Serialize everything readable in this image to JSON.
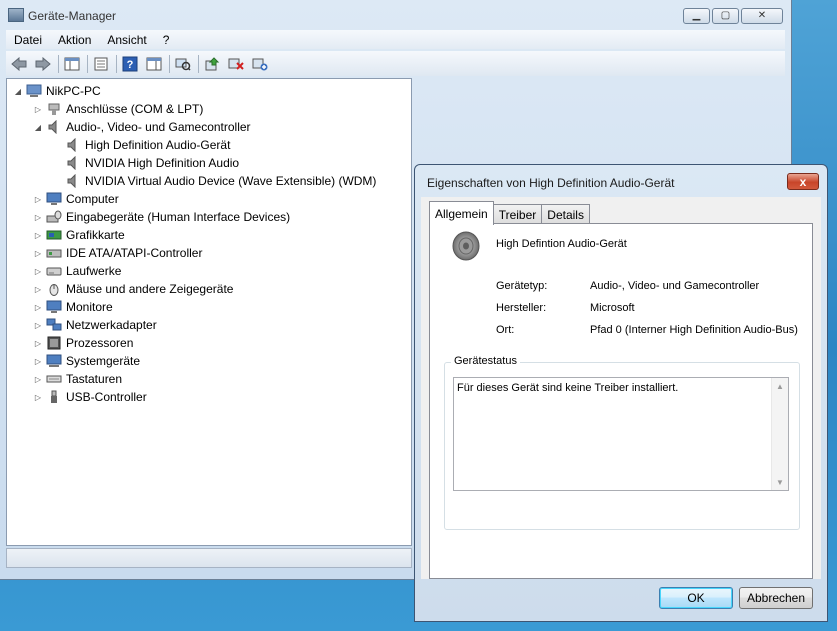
{
  "main_window": {
    "title": "Geräte-Manager",
    "caption_buttons": {
      "minimize": "▁",
      "maximize": "▢",
      "close": "✕"
    },
    "menu": [
      "Datei",
      "Aktion",
      "Ansicht",
      "?"
    ],
    "toolbar_icons": [
      "back-arrow-icon",
      "forward-arrow-icon",
      "show-hide-tree-icon",
      "properties-icon",
      "help-icon",
      "action-pane-icon",
      "scan-hardware-icon",
      "update-driver-icon",
      "disable-device-icon",
      "uninstall-device-icon"
    ],
    "tree": [
      {
        "label": "NikPC-PC",
        "level": 0,
        "arrow": "◢",
        "icon": "computer-icon"
      },
      {
        "label": "Anschlüsse (COM & LPT)",
        "level": 1,
        "arrow": "▷",
        "icon": "port-icon"
      },
      {
        "label": "Audio-, Video- und Gamecontroller",
        "level": 1,
        "arrow": "◢",
        "icon": "speaker-icon"
      },
      {
        "label": "High Definition Audio-Gerät",
        "level": 2,
        "arrow": "",
        "icon": "speaker-icon"
      },
      {
        "label": "NVIDIA High Definition Audio",
        "level": 2,
        "arrow": "",
        "icon": "speaker-icon"
      },
      {
        "label": "NVIDIA Virtual Audio Device (Wave Extensible) (WDM)",
        "level": 2,
        "arrow": "",
        "icon": "speaker-icon"
      },
      {
        "label": "Computer",
        "level": 1,
        "arrow": "▷",
        "icon": "monitor-icon"
      },
      {
        "label": "Eingabegeräte (Human Interface Devices)",
        "level": 1,
        "arrow": "▷",
        "icon": "hid-icon"
      },
      {
        "label": "Grafikkarte",
        "level": 1,
        "arrow": "▷",
        "icon": "display-adapter-icon"
      },
      {
        "label": "IDE ATA/ATAPI-Controller",
        "level": 1,
        "arrow": "▷",
        "icon": "ide-icon"
      },
      {
        "label": "Laufwerke",
        "level": 1,
        "arrow": "▷",
        "icon": "drive-icon"
      },
      {
        "label": "Mäuse und andere Zeigegeräte",
        "level": 1,
        "arrow": "▷",
        "icon": "mouse-icon"
      },
      {
        "label": "Monitore",
        "level": 1,
        "arrow": "▷",
        "icon": "monitor-icon"
      },
      {
        "label": "Netzwerkadapter",
        "level": 1,
        "arrow": "▷",
        "icon": "network-icon"
      },
      {
        "label": "Prozessoren",
        "level": 1,
        "arrow": "▷",
        "icon": "processor-icon"
      },
      {
        "label": "Systemgeräte",
        "level": 1,
        "arrow": "▷",
        "icon": "system-devices-icon"
      },
      {
        "label": "Tastaturen",
        "level": 1,
        "arrow": "▷",
        "icon": "keyboard-icon"
      },
      {
        "label": "USB-Controller",
        "level": 1,
        "arrow": "▷",
        "icon": "usb-icon"
      }
    ]
  },
  "dialog": {
    "title": "Eigenschaften von High Definition Audio-Gerät",
    "close": "x",
    "tabs": [
      "Allgemein",
      "Treiber",
      "Details"
    ],
    "device_name": "High Defintion Audio-Gerät",
    "properties": [
      {
        "label": "Gerätetyp:",
        "value": "Audio-, Video- und Gamecontroller"
      },
      {
        "label": "Hersteller:",
        "value": "Microsoft"
      },
      {
        "label": "Ort:",
        "value": "Pfad 0 (Interner High Definition Audio-Bus)"
      }
    ],
    "status_group_label": "Gerätestatus",
    "status_text": "Für dieses Gerät sind keine Treiber installiert.",
    "ok_label": "OK",
    "cancel_label": "Abbrechen"
  }
}
